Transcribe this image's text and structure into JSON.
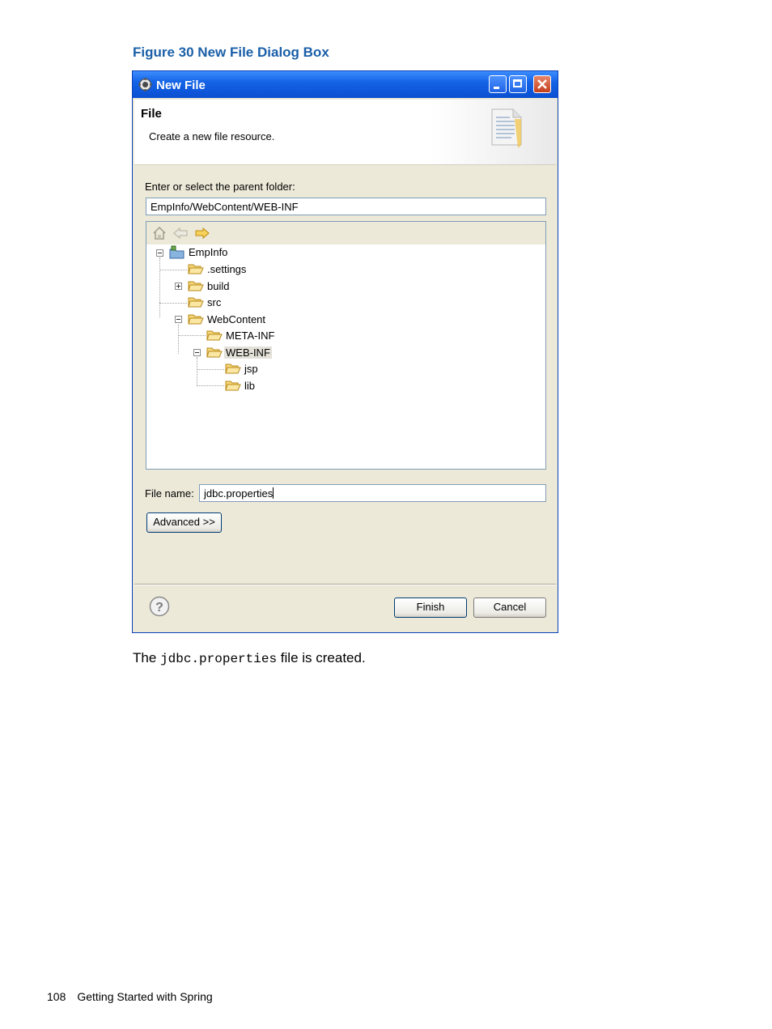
{
  "figure_caption": "Figure 30 New File Dialog Box",
  "dialog": {
    "title": "New File",
    "header_title": "File",
    "header_description": "Create a new file resource.",
    "parent_folder_label": "Enter or select the parent folder:",
    "parent_folder_value": "EmpInfo/WebContent/WEB-INF",
    "tree": {
      "nodes": [
        "EmpInfo",
        ".settings",
        "build",
        "src",
        "WebContent",
        "META-INF",
        "WEB-INF",
        "jsp",
        "lib"
      ],
      "selected": "WEB-INF"
    },
    "file_name_label": "File name:",
    "file_name_value": "jdbc.properties",
    "advanced_button": "Advanced >>",
    "finish_button": "Finish",
    "cancel_button": "Cancel"
  },
  "body_text": {
    "before": "The",
    "code": "jdbc.properties",
    "after": "file is created."
  },
  "footer": {
    "page_number": "108",
    "title": "Getting Started with Spring"
  },
  "colors": {
    "caption": "#1a5fa8",
    "titlebar": "#0a4fd2",
    "dialog_bg": "#ece9d8"
  }
}
